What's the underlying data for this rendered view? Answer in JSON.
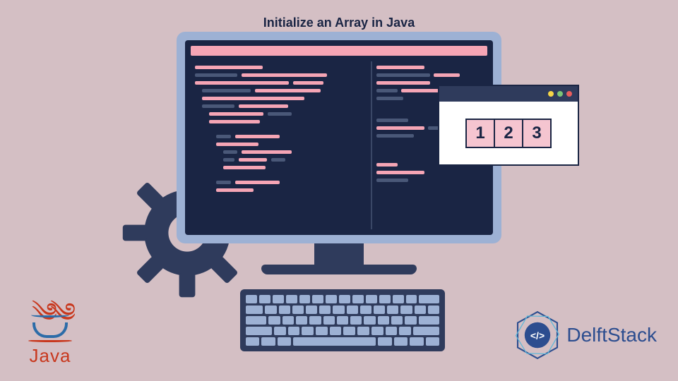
{
  "title": "Initialize an Array in Java",
  "array": {
    "cells": [
      "1",
      "2",
      "3"
    ]
  },
  "logos": {
    "java": "Java",
    "delft": "DelftStack",
    "delft_badge": "</>"
  },
  "colors": {
    "bg": "#d4bfc4",
    "dark": "#1a2544",
    "pink": "#f5a5b5",
    "frame": "#9db1d4"
  }
}
